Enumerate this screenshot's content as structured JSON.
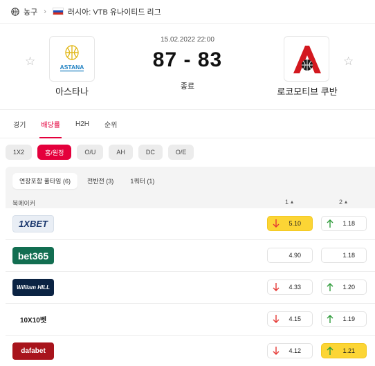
{
  "breadcrumb": {
    "sport": "농구",
    "league": "러시아: VTB 유나이티드 리그"
  },
  "match": {
    "datetime": "15.02.2022 22:00",
    "score": "87 - 83",
    "status": "종료",
    "home": {
      "name": "아스타나",
      "logo_text": "ASTANA"
    },
    "away": {
      "name": "로코모티브 쿠반"
    }
  },
  "tabs": [
    {
      "label": "경기",
      "active": false
    },
    {
      "label": "배당률",
      "active": true
    },
    {
      "label": "H2H",
      "active": false
    },
    {
      "label": "순위",
      "active": false
    }
  ],
  "markets": [
    {
      "label": "1X2",
      "active": false
    },
    {
      "label": "홈/원정",
      "active": true
    },
    {
      "label": "O/U",
      "active": false
    },
    {
      "label": "AH",
      "active": false
    },
    {
      "label": "DC",
      "active": false
    },
    {
      "label": "O/E",
      "active": false
    }
  ],
  "periods": [
    {
      "label": "연장포함 풀타임 (6)",
      "active": true
    },
    {
      "label": "전반전 (3)",
      "active": false
    },
    {
      "label": "1쿼터 (1)",
      "active": false
    }
  ],
  "table": {
    "bookmaker_header": "북메이커",
    "col1": "1",
    "col2": "2"
  },
  "bookmakers": [
    {
      "name": "1XBET",
      "odd1": "5.10",
      "dir1": "down",
      "hl1": true,
      "odd2": "1.18",
      "dir2": "up",
      "hl2": false
    },
    {
      "name": "bet365",
      "odd1": "4.90",
      "dir1": "",
      "hl1": false,
      "odd2": "1.18",
      "dir2": "",
      "hl2": false
    },
    {
      "name": "William HILL",
      "odd1": "4.33",
      "dir1": "down",
      "hl1": false,
      "odd2": "1.20",
      "dir2": "up",
      "hl2": false
    },
    {
      "name": "10X10벳",
      "odd1": "4.15",
      "dir1": "down",
      "hl1": false,
      "odd2": "1.19",
      "dir2": "up",
      "hl2": false
    },
    {
      "name": "dafabet",
      "odd1": "4.12",
      "dir1": "down",
      "hl1": false,
      "odd2": "1.21",
      "dir2": "up",
      "hl2": true
    }
  ],
  "colors": {
    "accent": "#e4003c",
    "highlight": "#fcd535",
    "up": "#2e9b3a",
    "down": "#e53935"
  }
}
